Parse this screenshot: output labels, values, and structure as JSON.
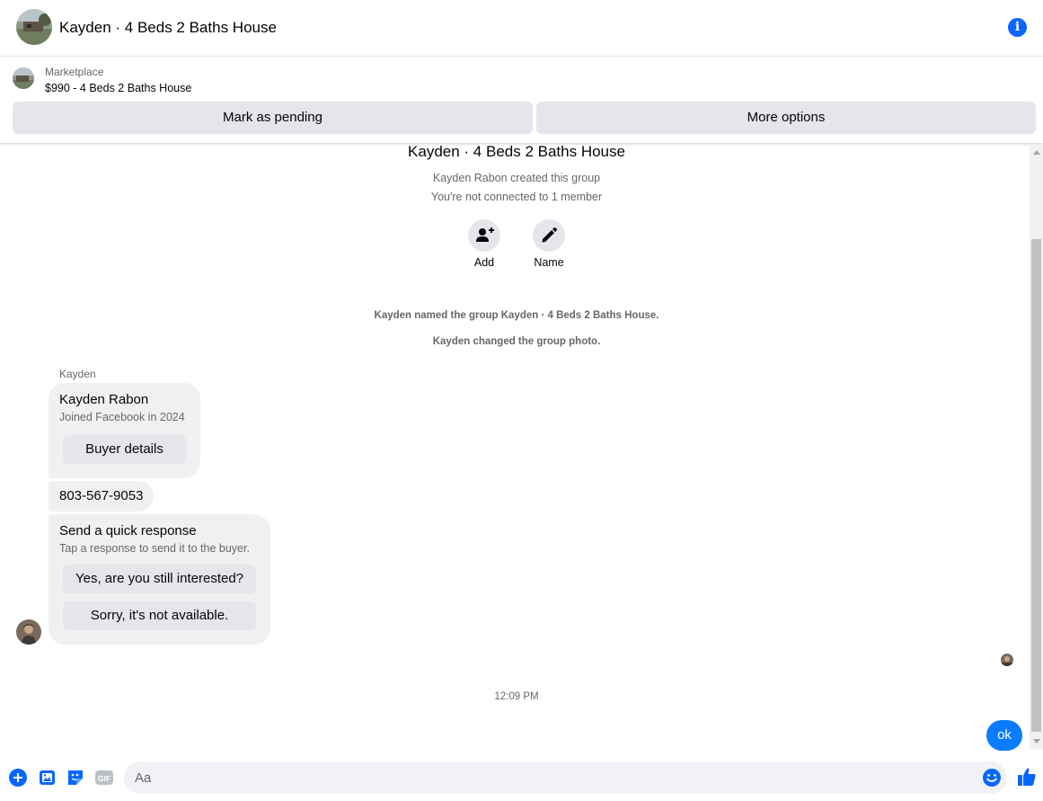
{
  "header": {
    "title": "Kayden · 4 Beds 2 Baths House",
    "info_icon": "info-icon",
    "info_glyph": "i"
  },
  "marketplace": {
    "label": "Marketplace",
    "listing": "$990 - 4 Beds 2 Baths House",
    "mark_pending_label": "Mark as pending",
    "more_options_label": "More options"
  },
  "group": {
    "title": "Kayden · 4 Beds 2 Baths House",
    "created_by": "Kayden Rabon created this group",
    "connection": "You're not connected to 1 member",
    "add_label": "Add",
    "name_label": "Name"
  },
  "system_messages": [
    "Kayden named the group Kayden · 4 Beds 2 Baths House.",
    "Kayden changed the group photo."
  ],
  "messages": {
    "sender_name": "Kayden",
    "profile_card": {
      "name": "Kayden Rabon",
      "joined": "Joined Facebook in 2024",
      "button_label": "Buyer details"
    },
    "phone": "803-567-9053",
    "quick_response": {
      "title": "Send a quick response",
      "subtitle": "Tap a response to send it to the buyer.",
      "option1": "Yes, are you still interested?",
      "option2": "Sorry, it's not available."
    },
    "timestamp": "12:09 PM",
    "my_message": "ok"
  },
  "composer": {
    "placeholder": "Aa",
    "gif_label": "GIF"
  },
  "colors": {
    "accent": "#0866ff",
    "my_bubble": "#0a7cff",
    "bubble_gray": "#f0f0f0",
    "button_gray": "#e4e6eb",
    "secondary_text": "#65676b"
  }
}
